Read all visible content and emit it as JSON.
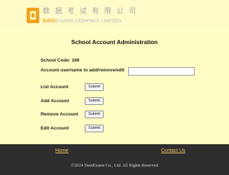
{
  "header": {
    "logo_cn": "数 据 考 试 有 限 公 司",
    "logo_en_bold": "DATA",
    "logo_en_light": "EXAMS COMPANY LIMITED"
  },
  "main": {
    "title": "School Account Administration",
    "school_code_label": "School Code: 166",
    "username_label": "Account username to add/remove/edit",
    "username_value": "",
    "rows": [
      {
        "label": "List Account",
        "button": "Submit"
      },
      {
        "label": "Add Account",
        "button": "Submit"
      },
      {
        "label": "Remove Account",
        "button": "Submit"
      },
      {
        "label": "Edit Account",
        "button": "Submit"
      }
    ]
  },
  "footer": {
    "home_link": "Home",
    "contact_link": "Contact Us",
    "copyright": "©2024 DataExams Co., Ltd.    All Rights Reserved"
  },
  "colors": {
    "header_bg": "#fefbc9",
    "main_bg": "#fefec4",
    "footer_bg": "#2e2e2e",
    "logo_accent": "#f2a21a",
    "footer_link": "#f2c96a"
  }
}
